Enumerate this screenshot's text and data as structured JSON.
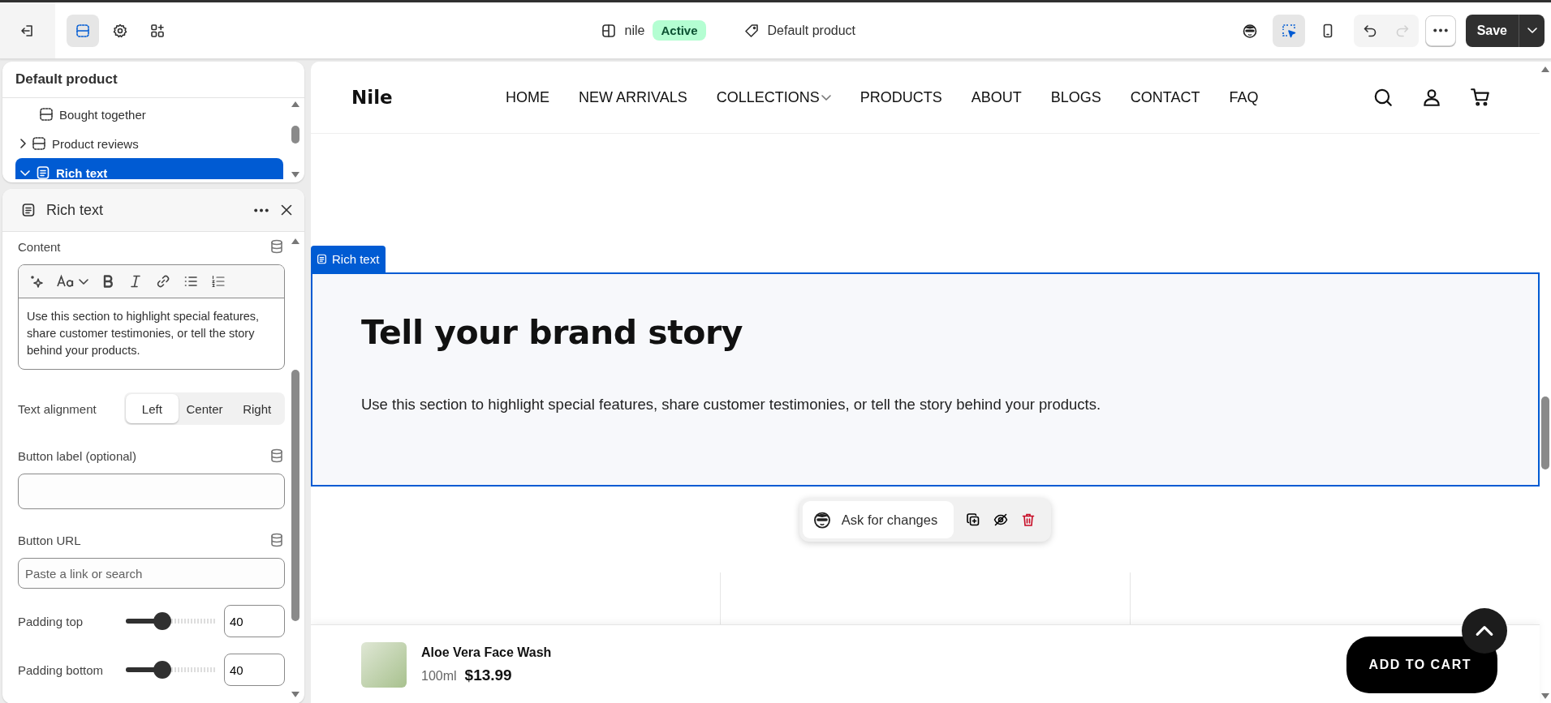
{
  "topbar": {
    "store_name": "nile",
    "store_status": "Active",
    "template": "Default product",
    "save_label": "Save"
  },
  "left_tools": [
    {
      "kind": "sections",
      "selected": true
    },
    {
      "kind": "settings",
      "selected": false
    },
    {
      "kind": "apps",
      "selected": false
    }
  ],
  "right_tools": [
    {
      "kind": "assistant",
      "selected": false
    },
    {
      "kind": "inspector",
      "selected": true
    },
    {
      "kind": "mobile",
      "selected": false
    }
  ],
  "history": [
    {
      "kind": "undo",
      "disabled": false
    },
    {
      "kind": "redo",
      "disabled": true
    }
  ],
  "tree": {
    "title": "Default product",
    "items": [
      {
        "label": "Bought together",
        "selected": false
      },
      {
        "label": "Product reviews",
        "expanded": false,
        "selected": false
      },
      {
        "label": "Rich text",
        "expanded": true,
        "selected": true
      }
    ]
  },
  "settings": {
    "title": "Rich text",
    "content_label": "Content",
    "content_text": "Use this section to highlight special features, share customer testimonies, or tell the story behind your products.",
    "alignment_label": "Text alignment",
    "alignment_options": [
      {
        "label": "Left",
        "selected": true
      },
      {
        "label": "Center",
        "selected": false
      },
      {
        "label": "Right",
        "selected": false
      }
    ],
    "button_label_label": "Button label (optional)",
    "button_url_label": "Button URL",
    "button_url_placeholder": "Paste a link or search",
    "sliders": [
      {
        "label": "Padding top",
        "level": 0.4,
        "value": "40"
      },
      {
        "label": "Padding bottom",
        "level": 0.4,
        "value": "40"
      }
    ]
  },
  "preview": {
    "logo": "Nile",
    "nav": [
      {
        "label": "HOME",
        "has_menu": false
      },
      {
        "label": "NEW ARRIVALS",
        "has_menu": false
      },
      {
        "label": "COLLECTIONS",
        "has_menu": true
      },
      {
        "label": "PRODUCTS",
        "has_menu": false
      },
      {
        "label": "ABOUT",
        "has_menu": false
      },
      {
        "label": "BLOGS",
        "has_menu": false
      },
      {
        "label": "CONTACT",
        "has_menu": false
      },
      {
        "label": "FAQ",
        "has_menu": false
      }
    ],
    "section_tag": "Rich text",
    "heading": "Tell your brand story",
    "body": "Use this section to highlight special features, share customer testimonies, or tell the story behind your products.",
    "ask_label": "Ask for changes",
    "product": {
      "name": "Aloe Vera Face Wash",
      "variant": "100ml",
      "price": "$13.99"
    },
    "add_to_cart": "ADD TO CART"
  }
}
